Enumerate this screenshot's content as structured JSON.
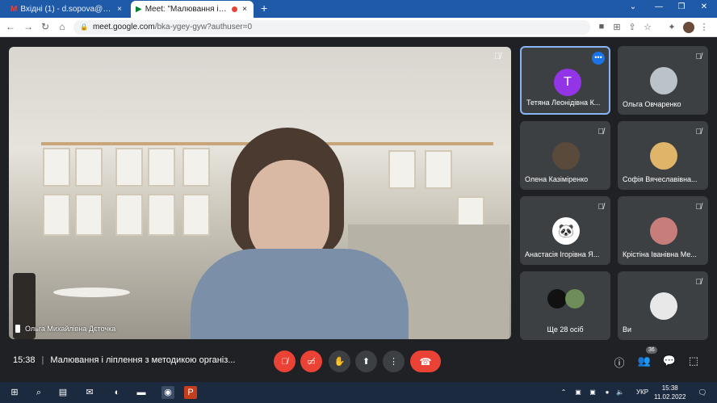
{
  "browser": {
    "tabs": [
      {
        "label": "Вхідні (1) - d.sopova@kubg.edu",
        "close": "×",
        "icon": "M",
        "icon_color": "#ea4335"
      },
      {
        "label": "Meet: \"Малювання і ліплен",
        "close": "×",
        "icon": "▶",
        "icon_color": "#00832d"
      }
    ],
    "new_tab": "+",
    "url_lock": "🔒",
    "url_host": "meet.google.com",
    "url_path": "/bka-ygey-gyw?authuser=0",
    "win_min": "—",
    "win_max": "❐",
    "win_close": "✕",
    "win_chevron": "⌄"
  },
  "meeting": {
    "time": "15:38",
    "title": "Малювання і ліплення з методикою організ...",
    "main_speaker": "Ольга Михайлівна Дєточка",
    "participants": [
      {
        "name": "Тетяна Леонідівна К...",
        "initial": "T",
        "avatar_color": "#9334e6"
      },
      {
        "name": "Ольга Овчаренко",
        "initial": "",
        "avatar_color": "#b9c3c9"
      },
      {
        "name": "Олена Казіміренко",
        "initial": "",
        "avatar_color": "#5a4a3b"
      },
      {
        "name": "Софія Вячеславівна...",
        "initial": "",
        "avatar_color": "#e0b56a"
      },
      {
        "name": "Анастасія Ігорівна Я...",
        "initial": "",
        "avatar_color": "#ffffff"
      },
      {
        "name": "Крістіна Іванівна Ме...",
        "initial": "",
        "avatar_color": "#c77d7a"
      },
      {
        "name": "Ще 28 осіб",
        "initial": "",
        "avatar_color": "#111111"
      },
      {
        "name": "Ви",
        "initial": "",
        "avatar_color": "#e8e8e8"
      }
    ],
    "people_count": "36"
  },
  "taskbar": {
    "lang": "УКР",
    "time": "15:38",
    "date": "11.02.2022"
  }
}
